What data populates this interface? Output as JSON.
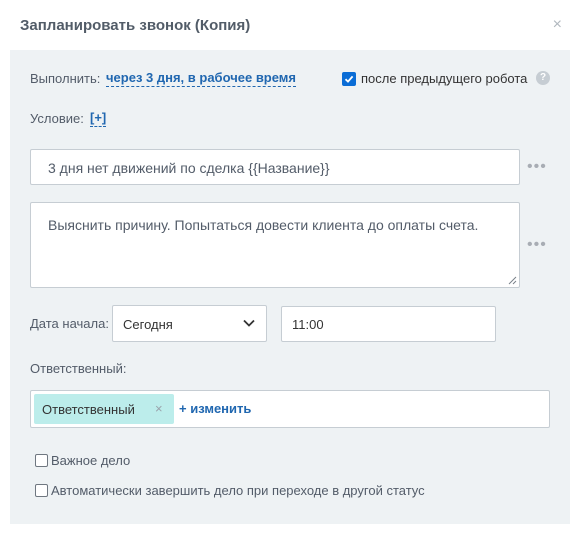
{
  "dialog": {
    "title": "Запланировать звонок (Копия)",
    "close_symbol": "×"
  },
  "execute": {
    "label": "Выполнить:",
    "value": "через 3 дня, в рабочее время",
    "after_previous_label": "после предыдущего робота",
    "after_previous_checked": true,
    "help_symbol": "?"
  },
  "condition": {
    "label": "Условие:",
    "add": "[+]"
  },
  "subject": {
    "value": "3 дня нет движений по сделка {{Название}}",
    "more_symbol": "•••"
  },
  "description": {
    "value": "Выяснить причину. Попытаться довести клиента до оплаты счета.",
    "more_symbol": "•••"
  },
  "start_date": {
    "label": "Дата начала:",
    "selected": "Сегодня",
    "time": "11:00"
  },
  "responsible": {
    "label": "Ответственный:",
    "tag": "Ответственный",
    "tag_remove_symbol": "×",
    "change_label": "+ изменить"
  },
  "options": {
    "important_label": "Важное дело",
    "important_checked": false,
    "auto_complete_label": "Автоматически завершить дело при переходе в другой статус",
    "auto_complete_checked": false
  },
  "colors": {
    "link": "#2067b0",
    "panel_bg": "#eef2f4",
    "tag_bg": "#bcedeb",
    "checkbox": "#0a6dd6"
  }
}
